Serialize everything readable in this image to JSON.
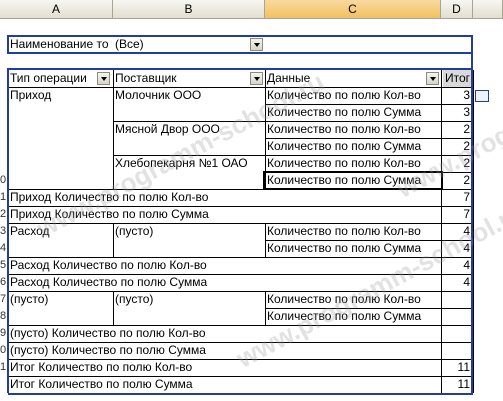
{
  "columns": [
    "A",
    "B",
    "C",
    "D"
  ],
  "page_field": {
    "label": "Наименование то",
    "value": "(Все)"
  },
  "headers": {
    "op_type": "Тип операции",
    "supplier": "Поставщик",
    "data": "Данные",
    "total": "Итог"
  },
  "rows": [
    {
      "a": "Приход",
      "b": "Молочник ООО",
      "c": "Количество по полю Кол-во",
      "d": "3"
    },
    {
      "a": "",
      "b": "",
      "c": "Количество по полю Сумма",
      "d": "3"
    },
    {
      "a": "",
      "b": "Мясной Двор ООО",
      "c": "Количество по полю Кол-во",
      "d": "2"
    },
    {
      "a": "",
      "b": "",
      "c": "Количество по полю Сумма",
      "d": "2"
    },
    {
      "a": "",
      "b": "Хлебопекарня №1 ОАО",
      "c": "Количество по полю Кол-во",
      "d": "2"
    },
    {
      "a": "",
      "b": "",
      "c": "Количество по полю Сумма",
      "d": "2"
    },
    {
      "a": "Приход Количество по полю Кол-во",
      "b": "",
      "c": "",
      "d": "7"
    },
    {
      "a": "Приход Количество по полю Сумма",
      "b": "",
      "c": "",
      "d": "7"
    },
    {
      "a": "Расход",
      "b": "(пусто)",
      "c": "Количество по полю Кол-во",
      "d": "4"
    },
    {
      "a": "",
      "b": "",
      "c": "Количество по полю Сумма",
      "d": "4"
    },
    {
      "a": "Расход Количество по полю Кол-во",
      "b": "",
      "c": "",
      "d": "4"
    },
    {
      "a": "Расход Количество по полю Сумма",
      "b": "",
      "c": "",
      "d": "4"
    },
    {
      "a": "(пусто)",
      "b": "(пусто)",
      "c": "Количество по полю Кол-во",
      "d": ""
    },
    {
      "a": "",
      "b": "",
      "c": "Количество по полю Сумма",
      "d": ""
    },
    {
      "a": "(пусто) Количество по полю Кол-во",
      "b": "",
      "c": "",
      "d": ""
    },
    {
      "a": "(пусто) Количество по полю Сумма",
      "b": "",
      "c": "",
      "d": ""
    },
    {
      "a": "Итог Количество по полю Кол-во",
      "b": "",
      "c": "",
      "d": "11"
    },
    {
      "a": "Итог Количество по полю Сумма",
      "b": "",
      "c": "",
      "d": "11"
    }
  ],
  "row_numbers": [
    "0",
    "1",
    "2",
    "3",
    "4",
    "5",
    "6",
    "7",
    "8",
    "9",
    "0",
    "1"
  ],
  "watermark": "www.programm-school.ru"
}
